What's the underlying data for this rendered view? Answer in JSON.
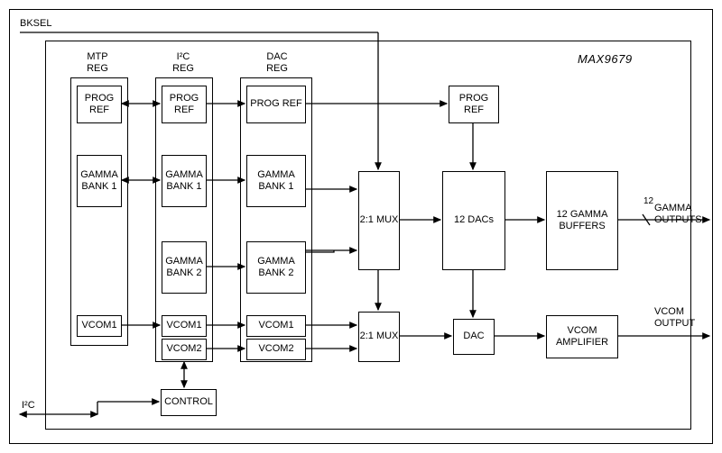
{
  "chip_name": "MAX9679",
  "inputs": {
    "bksel": "BKSEL",
    "i2c": "I²C"
  },
  "outputs": {
    "gamma": "GAMMA\nOUTPUTS",
    "gamma_count": "12",
    "vcom": "VCOM\nOUTPUT"
  },
  "cols": {
    "mtp_reg": "MTP\nREG",
    "i2c_reg": "I²C\nREG",
    "dac_reg": "DAC\nREG"
  },
  "blocks": {
    "prog_ref_mtp": "PROG\nREF",
    "prog_ref_i2c": "PROG\nREF",
    "prog_ref_dac": "PROG\nREF",
    "prog_ref_top": "PROG\nREF",
    "gamma_bank1_mtp": "GAMMA\nBANK 1",
    "gamma_bank1_i2c": "GAMMA\nBANK 1",
    "gamma_bank1_dac": "GAMMA\nBANK 1",
    "gamma_bank2_i2c": "GAMMA\nBANK 2",
    "gamma_bank2_dac": "GAMMA\nBANK 2",
    "vcom1_mtp": "VCOM1",
    "vcom1_i2c": "VCOM1",
    "vcom1_dac": "VCOM1",
    "vcom2_i2c": "VCOM2",
    "vcom2_dac": "VCOM2",
    "mux21_g": "2:1\nMUX",
    "mux21_v": "2:1\nMUX",
    "dacs12": "12 DACs",
    "dac": "DAC",
    "gamma_buffers": "12 GAMMA\nBUFFERS",
    "vcom_amp": "VCOM\nAMPLIFIER",
    "control": "CONTROL"
  }
}
